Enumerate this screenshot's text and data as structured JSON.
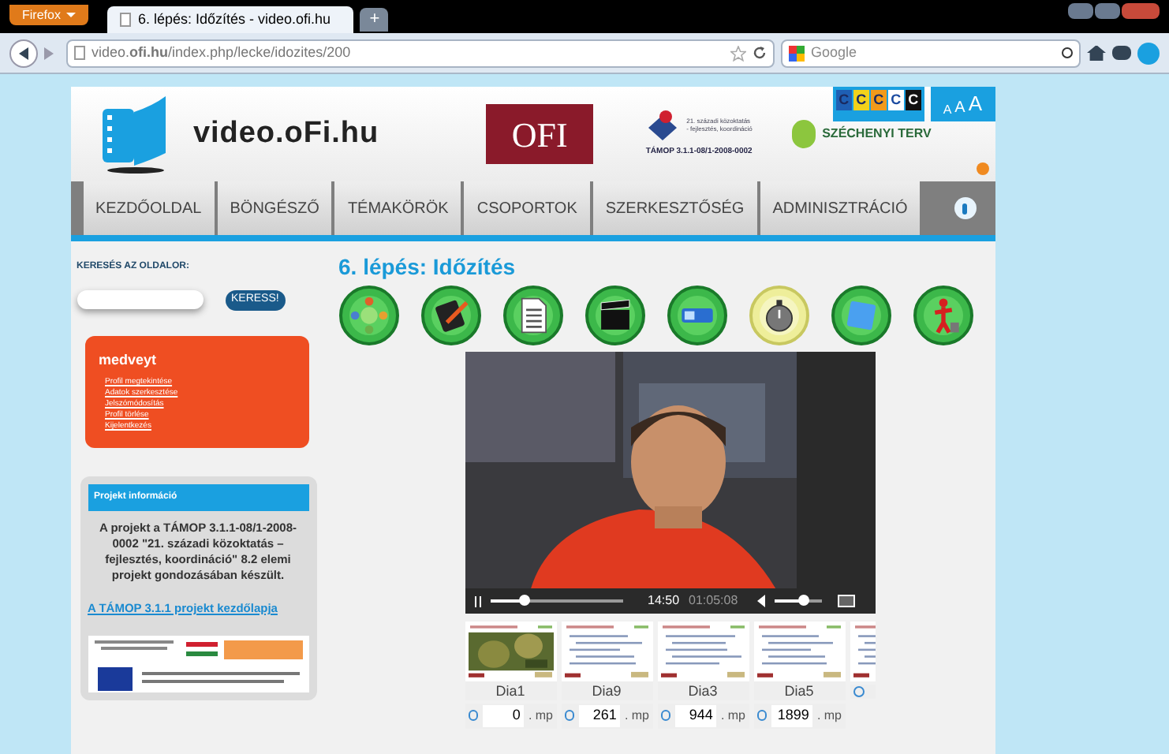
{
  "browser": {
    "menu_button": "Firefox",
    "tab": {
      "title": "6. lépés: Időzítés - video.ofi.hu",
      "selected": true
    },
    "new_tab": "+",
    "url": "video.**ofi.hu**/index.php/lecke/idozites/200",
    "search_placeholder": "Google"
  },
  "header": {
    "site_name": "video.oFi.hu",
    "ofi_logo": "OFI",
    "partner_caption": "21. századi közoktatás - fejlesztés, koordináció",
    "tamop_code": "TÁMOP 3.1.1-08/1-2008-0002",
    "szechenyi": "SZÉCHENYI TERV",
    "contrast_buttons": [
      {
        "label": "C",
        "color": "#1e5fb4"
      },
      {
        "label": "C",
        "color": "#f2d21a"
      },
      {
        "label": "C",
        "color": "#f29a1a"
      },
      {
        "label": "C",
        "color": "#ffffff"
      },
      {
        "label": "C",
        "color": "#111111"
      }
    ],
    "font_sizes": [
      "A",
      "A",
      "A"
    ]
  },
  "nav": [
    {
      "label": "KEZDŐOLDAL"
    },
    {
      "label": "BÖNGÉSZŐ"
    },
    {
      "label": "TÉMAKÖRÖK"
    },
    {
      "label": "CSOPORTOK"
    },
    {
      "label": "SZERKESZTŐSÉG"
    },
    {
      "label": "ADMINISZTRÁCIÓ"
    }
  ],
  "sidebar": {
    "search_label": "KERESÉS AZ OLDALOR:",
    "search_button": "KERESS!",
    "user": {
      "name": "medveyt",
      "links": [
        "Profil megtekintése",
        "Adatok szerkesztése",
        "Jelszómódosítás",
        "Profil törlése",
        "Kijelentkezés"
      ]
    },
    "project": {
      "title": "Projekt információ",
      "text": "A projekt a TÁMOP 3.1.1-08/1-2008-0002 \"21. századi közoktatás – fejlesztés, koordináció\" 8.2 elemi projekt gondozásában készült.",
      "link": "A TÁMOP 3.1.1 projekt kezdőlapja"
    }
  },
  "main": {
    "title": "6. lépés: Időzítés",
    "steps": [
      {
        "selected": false
      },
      {
        "selected": false
      },
      {
        "selected": false
      },
      {
        "selected": false
      },
      {
        "selected": false
      },
      {
        "selected": true
      },
      {
        "selected": false
      },
      {
        "selected": false
      }
    ],
    "player": {
      "progress": {
        "level": 0.25
      },
      "time": "14:50",
      "duration": "01:05:08",
      "volume": {
        "level": 0.6
      }
    },
    "slides": [
      {
        "label": "Dia1",
        "seconds": "0",
        "unit": ". mp"
      },
      {
        "label": "Dia9",
        "seconds": "261",
        "unit": ". mp",
        "kind": "list"
      },
      {
        "label": "Dia3",
        "seconds": "944",
        "unit": ". mp",
        "kind": "list"
      },
      {
        "label": "Dia5",
        "seconds": "1899",
        "unit": ". mp",
        "kind": "list"
      },
      {
        "kind": "list"
      }
    ]
  }
}
